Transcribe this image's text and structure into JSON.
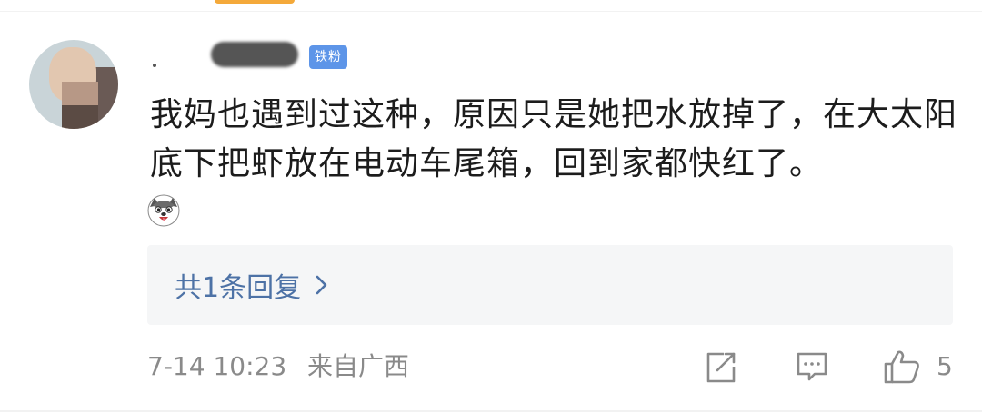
{
  "user": {
    "name_visible": "",
    "badge": "铁粉"
  },
  "comment": {
    "text": "我妈也遇到过这种，原因只是她把水放掉了，在大太阳底下把虾放在电动车尾箱，回到家都快红了。",
    "emoji": "dog-face-emoji"
  },
  "replies": {
    "label": "共1条回复",
    "icon": "chevron-right-icon"
  },
  "footer": {
    "timestamp": "7-14 10:23",
    "location": "来自广西",
    "like_count": "5"
  },
  "colors": {
    "badge": "#5d95e8",
    "reply_link": "#4d72a6",
    "meta_text": "#8a8a8a",
    "reply_bg": "#f5f6f7"
  }
}
